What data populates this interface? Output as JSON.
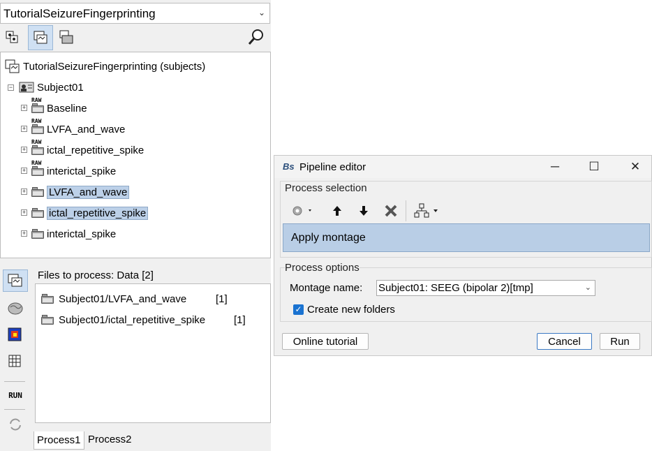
{
  "protocol_selector": {
    "value": "TutorialSeizureFingerprinting"
  },
  "toolbar_icons": [
    "subjects-view-icon",
    "functional-view-icon",
    "studies-view-icon",
    "search-icon"
  ],
  "tree": {
    "root_label": "TutorialSeizureFingerprinting (subjects)",
    "subject_label": "Subject01",
    "raw_tag": "RAW",
    "items": [
      {
        "label": "Baseline",
        "raw": true,
        "highlighted": false
      },
      {
        "label": "LVFA_and_wave",
        "raw": true,
        "highlighted": false
      },
      {
        "label": "ictal_repetitive_spike",
        "raw": true,
        "highlighted": false
      },
      {
        "label": "interictal_spike",
        "raw": true,
        "highlighted": false
      },
      {
        "label": "LVFA_and_wave",
        "raw": false,
        "highlighted": true
      },
      {
        "label": "ictal_repetitive_spike",
        "raw": false,
        "highlighted": true
      },
      {
        "label": "interictal_spike",
        "raw": false,
        "highlighted": false
      }
    ]
  },
  "sidebar": {
    "run_label": "RUN"
  },
  "files_to_process": {
    "header": "Files to process: Data [2]",
    "items": [
      {
        "path": "Subject01/LVFA_and_wave",
        "count": "[1]"
      },
      {
        "path": "Subject01/ictal_repetitive_spike",
        "count": "[1]"
      }
    ]
  },
  "process_tabs": [
    "Process1",
    "Process2"
  ],
  "pipeline_editor": {
    "title": "Pipeline editor",
    "logo_text": "Bs",
    "process_selection_label": "Process selection",
    "selected_process": "Apply montage",
    "process_options_label": "Process options",
    "montage_label": "Montage name:",
    "montage_value": "Subject01: SEEG (bipolar 2)[tmp]",
    "create_folders_label": "Create new folders",
    "create_folders_checked": true,
    "online_tutorial_label": "Online tutorial",
    "cancel_label": "Cancel",
    "run_label": "Run"
  }
}
